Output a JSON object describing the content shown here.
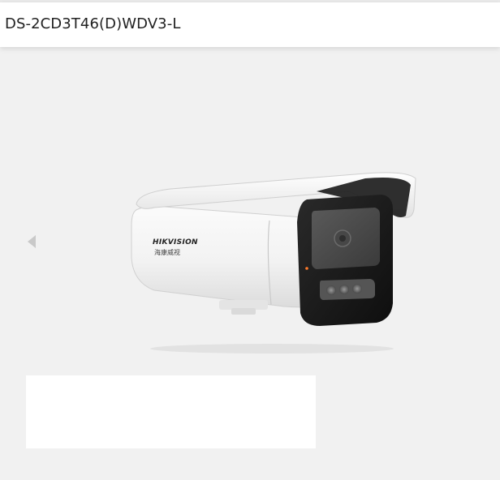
{
  "header": {
    "title": "DS-2CD3T46(D)WDV3-L"
  },
  "gallery": {
    "prev_icon": "chevron-left-icon"
  },
  "product": {
    "brand_logo": "HIKVISION",
    "brand_logo_cn": "海康威视"
  },
  "colors": {
    "background": "#f1f1f1",
    "header": "#ffffff",
    "title_text": "#222222"
  }
}
